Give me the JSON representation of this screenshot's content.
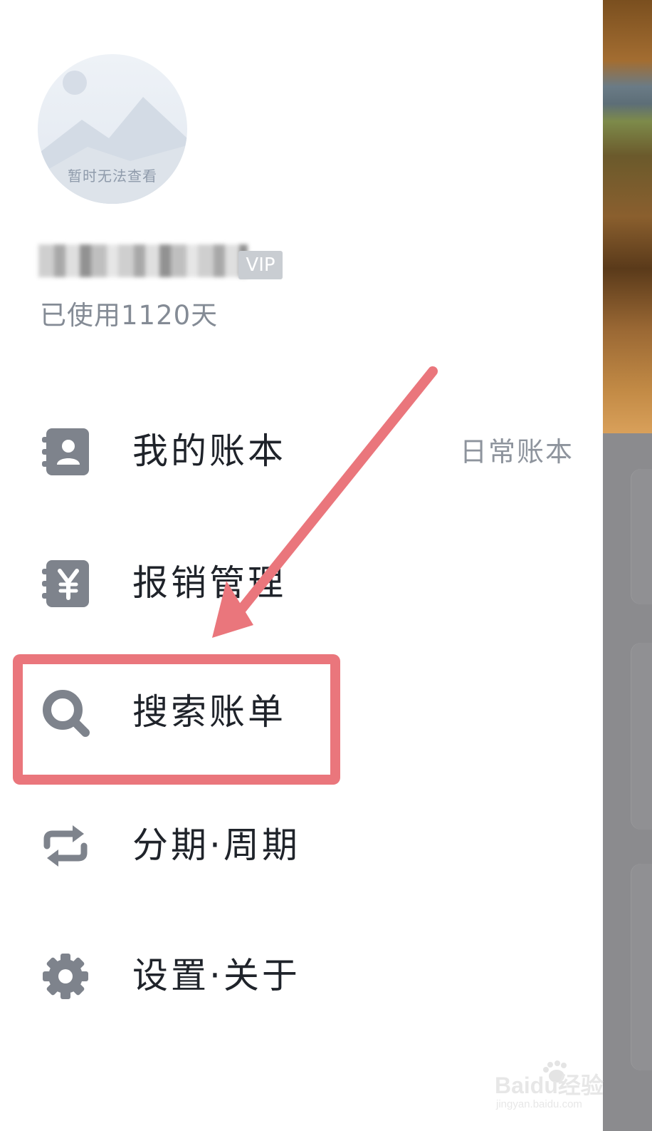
{
  "profile": {
    "avatar_caption": "暂时无法查看",
    "vip_label": "VIP",
    "days_used": "已使用1120天"
  },
  "menu": {
    "items": [
      {
        "label": "我的账本",
        "value": "日常账本",
        "icon": "contact-book-icon"
      },
      {
        "label": "报销管理",
        "icon": "yen-book-icon"
      },
      {
        "label": "搜索账单",
        "icon": "search-icon"
      },
      {
        "label": "分期·周期",
        "icon": "repeat-icon"
      },
      {
        "label": "设置·关于",
        "icon": "gear-icon"
      }
    ]
  },
  "colors": {
    "icon": "#7e838c",
    "text": "#1f232a",
    "muted": "#8e949d",
    "annotation": "#ea767c"
  },
  "watermark": {
    "brand": "Baidu经验",
    "url": "jingyan.baidu.com"
  }
}
